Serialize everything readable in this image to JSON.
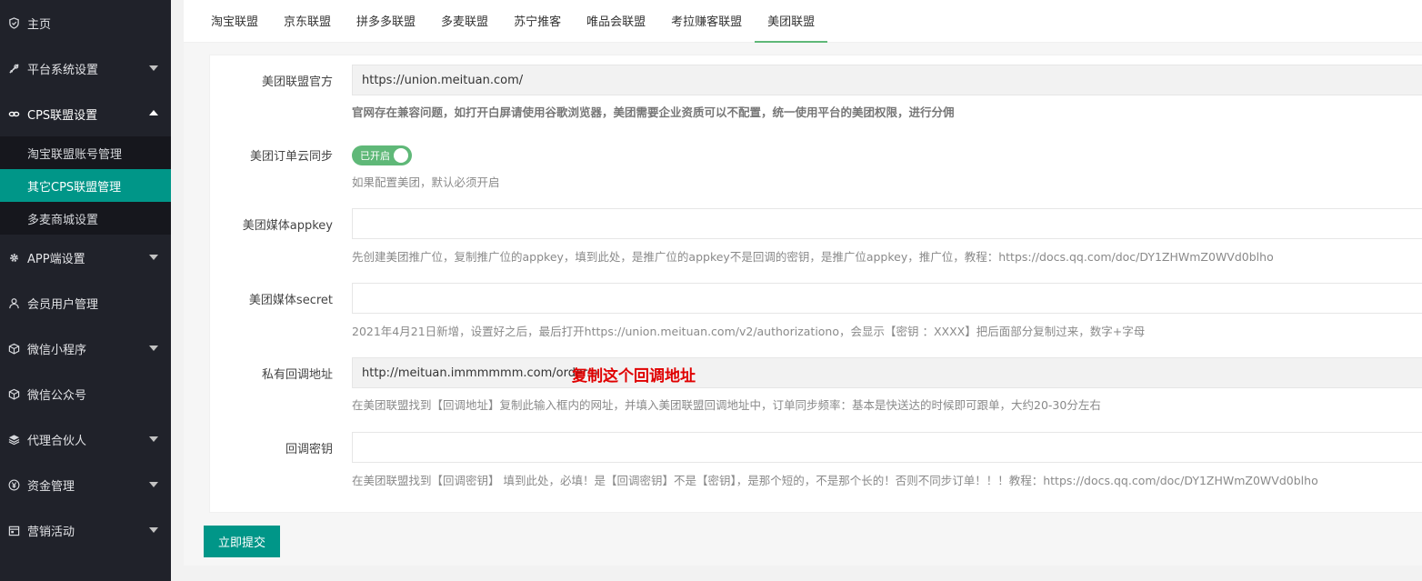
{
  "sidebar": {
    "items": [
      {
        "label": "主页",
        "icon": "shield-icon",
        "caret": ""
      },
      {
        "label": "平台系统设置",
        "icon": "tools-icon",
        "caret": "down"
      },
      {
        "label": "CPS联盟设置",
        "icon": "link-icon",
        "caret": "up"
      },
      {
        "label": "APP端设置",
        "icon": "gear-icon",
        "caret": "down"
      },
      {
        "label": "会员用户管理",
        "icon": "user-icon",
        "caret": ""
      },
      {
        "label": "微信小程序",
        "icon": "cube-icon",
        "caret": "down"
      },
      {
        "label": "微信公众号",
        "icon": "cube-icon",
        "caret": ""
      },
      {
        "label": "代理合伙人",
        "icon": "layers-icon",
        "caret": "down"
      },
      {
        "label": "资金管理",
        "icon": "yen-icon",
        "caret": "down"
      },
      {
        "label": "营销活动",
        "icon": "calendar-icon",
        "caret": "down"
      }
    ],
    "subitems": [
      {
        "label": "淘宝联盟账号管理",
        "active": false
      },
      {
        "label": "其它CPS联盟管理",
        "active": true
      },
      {
        "label": "多麦商城设置",
        "active": false
      }
    ]
  },
  "tabs": [
    "淘宝联盟",
    "京东联盟",
    "拼多多联盟",
    "多麦联盟",
    "苏宁推客",
    "唯品会联盟",
    "考拉赚客联盟",
    "美团联盟"
  ],
  "active_tab": "美团联盟",
  "form": {
    "official": {
      "label": "美团联盟官方",
      "value": "https://union.meituan.com/",
      "hint": "官网存在兼容问题，如打开白屏请使用谷歌浏览器，美团需要企业资质可以不配置，统一使用平台的美团权限，进行分佣"
    },
    "sync": {
      "label": "美团订单云同步",
      "switch_text": "已开启",
      "hint": "如果配置美团，默认必须开启"
    },
    "appkey": {
      "label": "美团媒体appkey",
      "value": "",
      "hint": "先创建美团推广位，复制推广位的appkey，填到此处，是推广位的appkey不是回调的密钥，是推广位appkey，推广位，教程：https://docs.qq.com/doc/DY1ZHWmZ0WVd0blho"
    },
    "secret": {
      "label": "美团媒体secret",
      "value": "",
      "hint": "2021年4月21日新增，设置好之后，最后打开https://union.meituan.com/v2/authorizationo，会显示【密钥 ：XXXX】把后面部分复制过来，数字+字母"
    },
    "callback": {
      "label": "私有回调地址",
      "value": "http://meituan.immmmmm.com/order.p",
      "annotation": "复制这个回调地址",
      "hint": "在美团联盟找到【回调地址】复制此输入框内的网址，并填入美团联盟回调地址中，订单同步频率：基本是快送达的时候即可跟单，大约20-30分左右"
    },
    "callback_key": {
      "label": "回调密钥",
      "value": "",
      "hint": "在美团联盟找到【回调密钥】 填到此处，必填！是【回调密钥】不是【密钥】，是那个短的，不是那个长的！否则不同步订单！！！教程：https://docs.qq.com/doc/DY1ZHWmZ0WVd0blho"
    }
  },
  "submit_label": "立即提交",
  "colors": {
    "primary": "#009688",
    "switch_on": "#5fb878",
    "sidebar_bg": "#20222a",
    "annotation": "#e00000"
  }
}
